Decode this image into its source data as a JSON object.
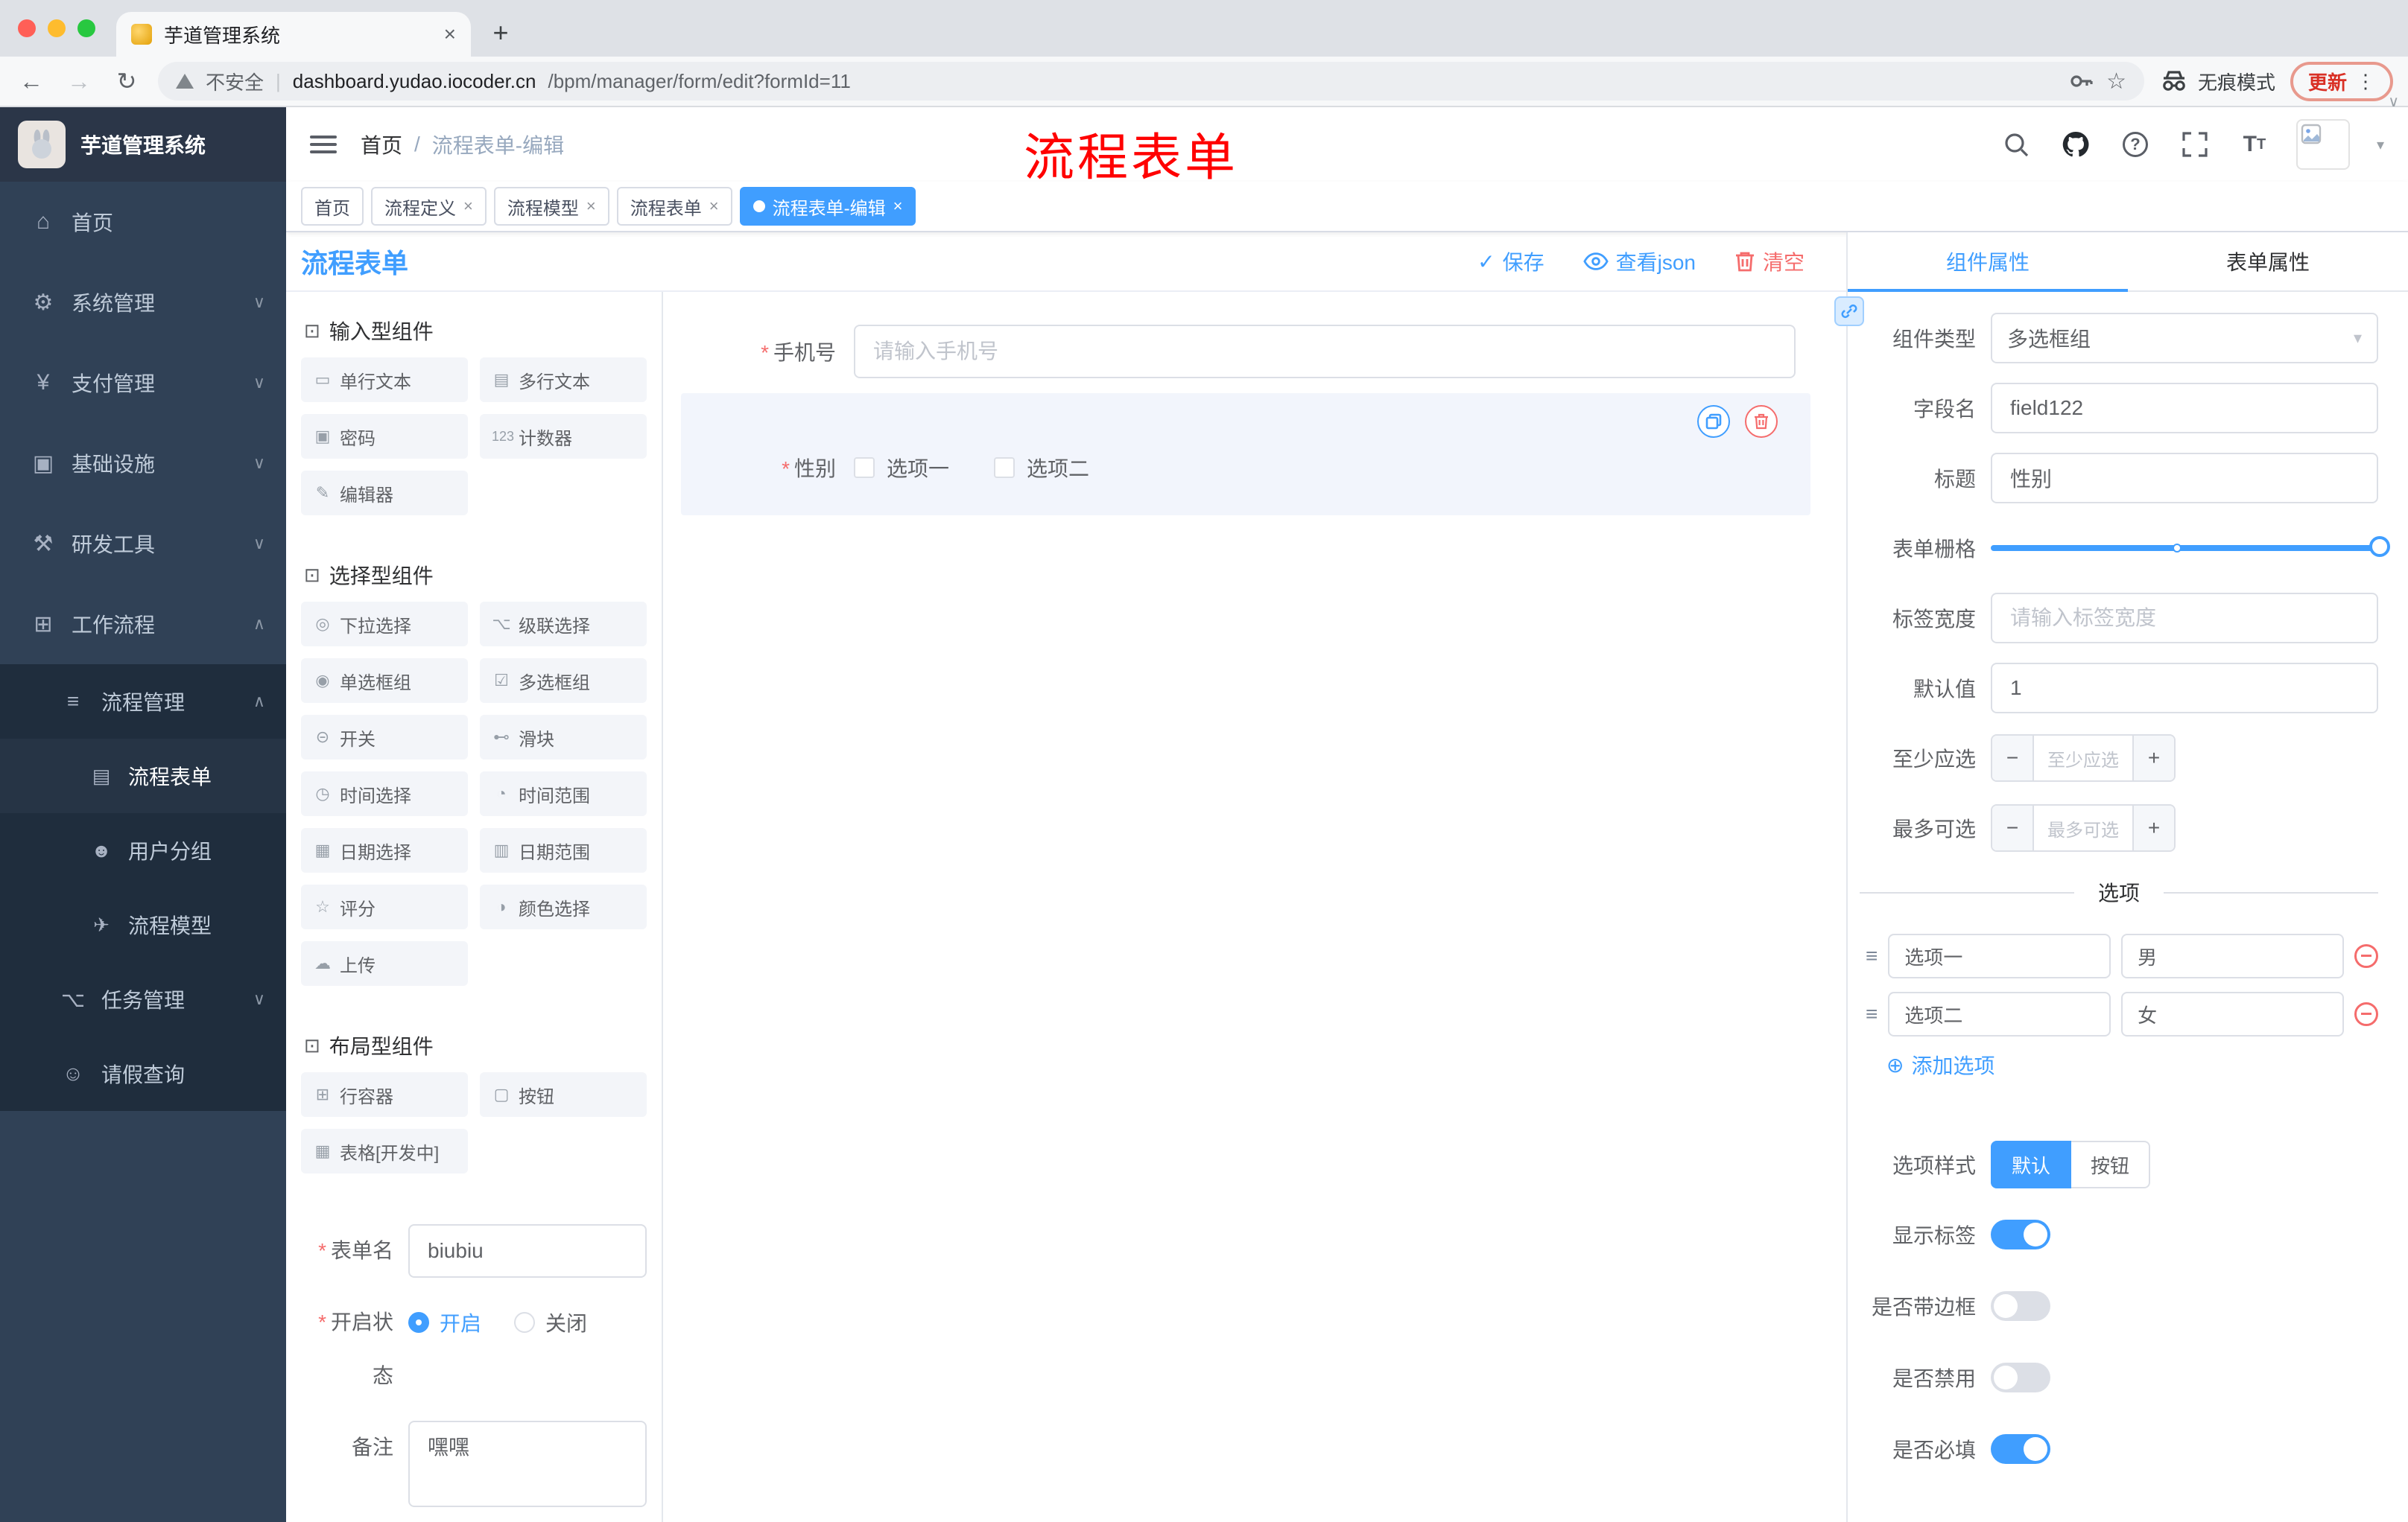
{
  "colors": {
    "accent": "#409EFF",
    "danger": "#F56C6C",
    "sidebar_bg": "#304156",
    "submenu_bg": "#1F2D3D",
    "annotation": "#FF0000",
    "update": "#D93025"
  },
  "browser": {
    "tab_title": "芋道管理系统",
    "not_secure": "不安全",
    "url_domain": "dashboard.yudao.iocoder.cn",
    "url_path": "/bpm/manager/form/edit?formId=11",
    "incognito_label": "无痕模式",
    "update_label": "更新"
  },
  "annotation": {
    "text": "流程表单"
  },
  "sidebar": {
    "logo": "芋道管理系统",
    "items": [
      {
        "label": "首页"
      },
      {
        "label": "系统管理"
      },
      {
        "label": "支付管理"
      },
      {
        "label": "基础设施"
      },
      {
        "label": "研发工具"
      },
      {
        "label": "工作流程"
      }
    ],
    "workflow": {
      "process_mgmt": "流程管理",
      "process_children": [
        {
          "label": "流程表单",
          "active": true
        },
        {
          "label": "用户分组",
          "active": false
        },
        {
          "label": "流程模型",
          "active": false
        }
      ],
      "task_mgmt": "任务管理",
      "leave_query": "请假查询"
    }
  },
  "header": {
    "breadcrumb_home": "首页",
    "breadcrumb_sep": "/",
    "breadcrumb_current": "流程表单-编辑"
  },
  "tags": [
    {
      "label": "首页",
      "closable": false,
      "active": false
    },
    {
      "label": "流程定义",
      "closable": true,
      "active": false
    },
    {
      "label": "流程模型",
      "closable": true,
      "active": false
    },
    {
      "label": "流程表单",
      "closable": true,
      "active": false
    },
    {
      "label": "流程表单-编辑",
      "closable": true,
      "active": true
    }
  ],
  "editor": {
    "title": "流程表单",
    "actions": {
      "save": "保存",
      "view_json": "查看json",
      "clear": "清空"
    },
    "component_groups": [
      {
        "title": "输入型组件",
        "items": [
          "单行文本",
          "多行文本",
          "密码",
          "计数器",
          "编辑器"
        ]
      },
      {
        "title": "选择型组件",
        "items": [
          "下拉选择",
          "级联选择",
          "单选框组",
          "多选框组",
          "开关",
          "滑块",
          "时间选择",
          "时间范围",
          "日期选择",
          "日期范围",
          "评分",
          "颜色选择",
          "上传"
        ]
      },
      {
        "title": "布局型组件",
        "items": [
          "行容器",
          "按钮",
          "表格[开发中]"
        ]
      }
    ],
    "meta": {
      "form_name_label": "表单名",
      "form_name_value": "biubiu",
      "status_label": "开启状态",
      "status_on": "开启",
      "status_off": "关闭",
      "status_selected": "开启",
      "remark_label": "备注",
      "remark_value": "嘿嘿"
    },
    "canvas": {
      "phone_label": "手机号",
      "phone_placeholder": "请输入手机号",
      "gender_label": "性别",
      "gender_option1": "选项一",
      "gender_option2": "选项二"
    }
  },
  "props": {
    "tab_component": "组件属性",
    "tab_form": "表单属性",
    "active_tab": "组件属性",
    "type_label": "组件类型",
    "type_value": "多选框组",
    "field_label": "字段名",
    "field_value": "field122",
    "title_label": "标题",
    "title_value": "性别",
    "grid_label": "表单栅格",
    "label_width_label": "标签宽度",
    "label_width_placeholder": "请输入标签宽度",
    "default_label": "默认值",
    "default_value": "1",
    "min_label": "至少应选",
    "min_placeholder": "至少应选",
    "max_label": "最多可选",
    "max_placeholder": "最多可选",
    "options_title": "选项",
    "options": [
      {
        "label": "选项一",
        "value": "男"
      },
      {
        "label": "选项二",
        "value": "女"
      }
    ],
    "add_option": "添加选项",
    "option_style_label": "选项样式",
    "option_style_default": "默认",
    "option_style_button": "按钮",
    "option_style_selected": "默认",
    "toggles": [
      {
        "label": "显示标签",
        "on": true
      },
      {
        "label": "是否带边框",
        "on": false
      },
      {
        "label": "是否禁用",
        "on": false
      },
      {
        "label": "是否必填",
        "on": true
      }
    ]
  }
}
